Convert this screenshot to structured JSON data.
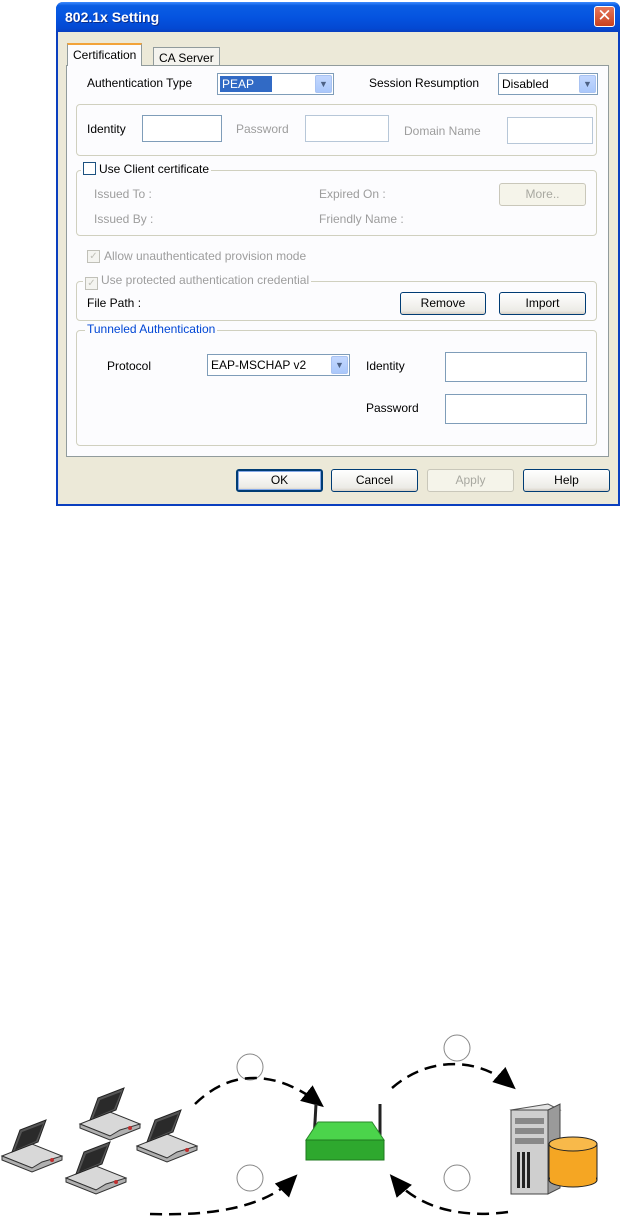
{
  "window": {
    "title": "802.1x Setting",
    "close_glyph": "✕"
  },
  "tabs": [
    {
      "label": "Certification",
      "active": true
    },
    {
      "label": "CA Server",
      "active": false
    }
  ],
  "certification": {
    "auth_type_label": "Authentication Type",
    "auth_type_value": "PEAP",
    "session_resumption_label": "Session Resumption",
    "session_resumption_value": "Disabled",
    "identity_label": "Identity",
    "identity_value": "",
    "password_label": "Password",
    "password_value": "",
    "domain_name_label": "Domain Name",
    "domain_name_value": "",
    "client_cert": {
      "checkbox_label": "Use Client certificate",
      "checked": false,
      "issued_to_label": "Issued To :",
      "expired_on_label": "Expired On :",
      "issued_by_label": "Issued By :",
      "friendly_name_label": "Friendly Name :",
      "more_button": "More.."
    },
    "allow_unauth_label": "Allow unauthenticated provision mode",
    "use_protected_label": "Use protected authentication credential",
    "file_path_label": "File Path :",
    "remove_button": "Remove",
    "import_button": "Import",
    "tunneled": {
      "legend": "Tunneled Authentication",
      "protocol_label": "Protocol",
      "protocol_value": "EAP-MSCHAP v2",
      "identity_label": "Identity",
      "identity_value": "",
      "password_label": "Password",
      "password_value": ""
    }
  },
  "footer": {
    "ok": "OK",
    "cancel": "Cancel",
    "apply": "Apply",
    "help": "Help"
  },
  "icons": {
    "check": "✓",
    "dropdown": "▼"
  },
  "diagram": {
    "colors": {
      "access_point": "#3cc63c",
      "database": "#f5a623",
      "arrow": "#000000"
    }
  }
}
